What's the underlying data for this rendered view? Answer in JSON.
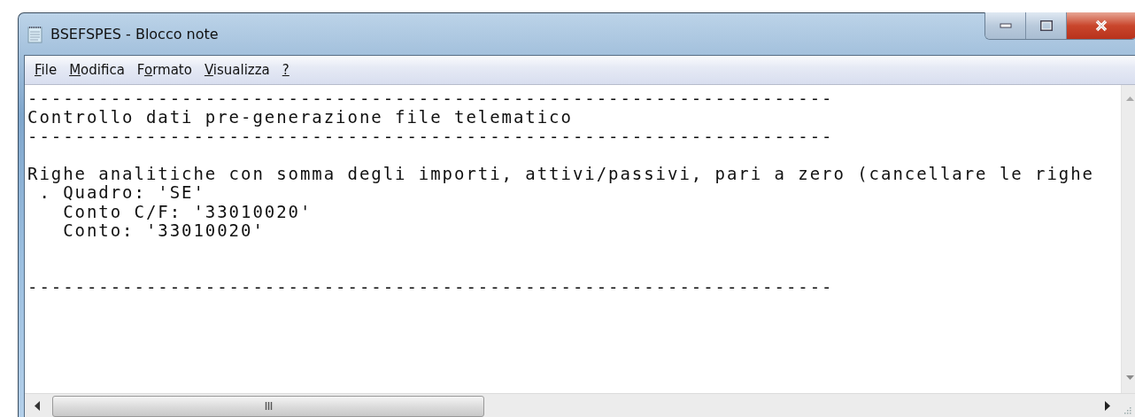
{
  "window": {
    "title": "BSEFSPES - Blocco note"
  },
  "menu": [
    {
      "access_key": "F",
      "rest": "ile"
    },
    {
      "access_key": "M",
      "rest": "odifica"
    },
    {
      "before": "F",
      "access_key": "o",
      "rest": "rmato"
    },
    {
      "access_key": "V",
      "rest": "isualizza"
    },
    {
      "access_key": "?"
    }
  ],
  "document": {
    "text": "--------------------------------------------------------------------\nControllo dati pre-generazione file telematico\n--------------------------------------------------------------------\n\nRighe analitiche con somma degli importi, attivi/passivi, pari a zero (cancellare le righe\n . Quadro: 'SE'\n   Conto C/F: '33010020'\n   Conto: '33010020'\n\n\n--------------------------------------------------------------------"
  }
}
